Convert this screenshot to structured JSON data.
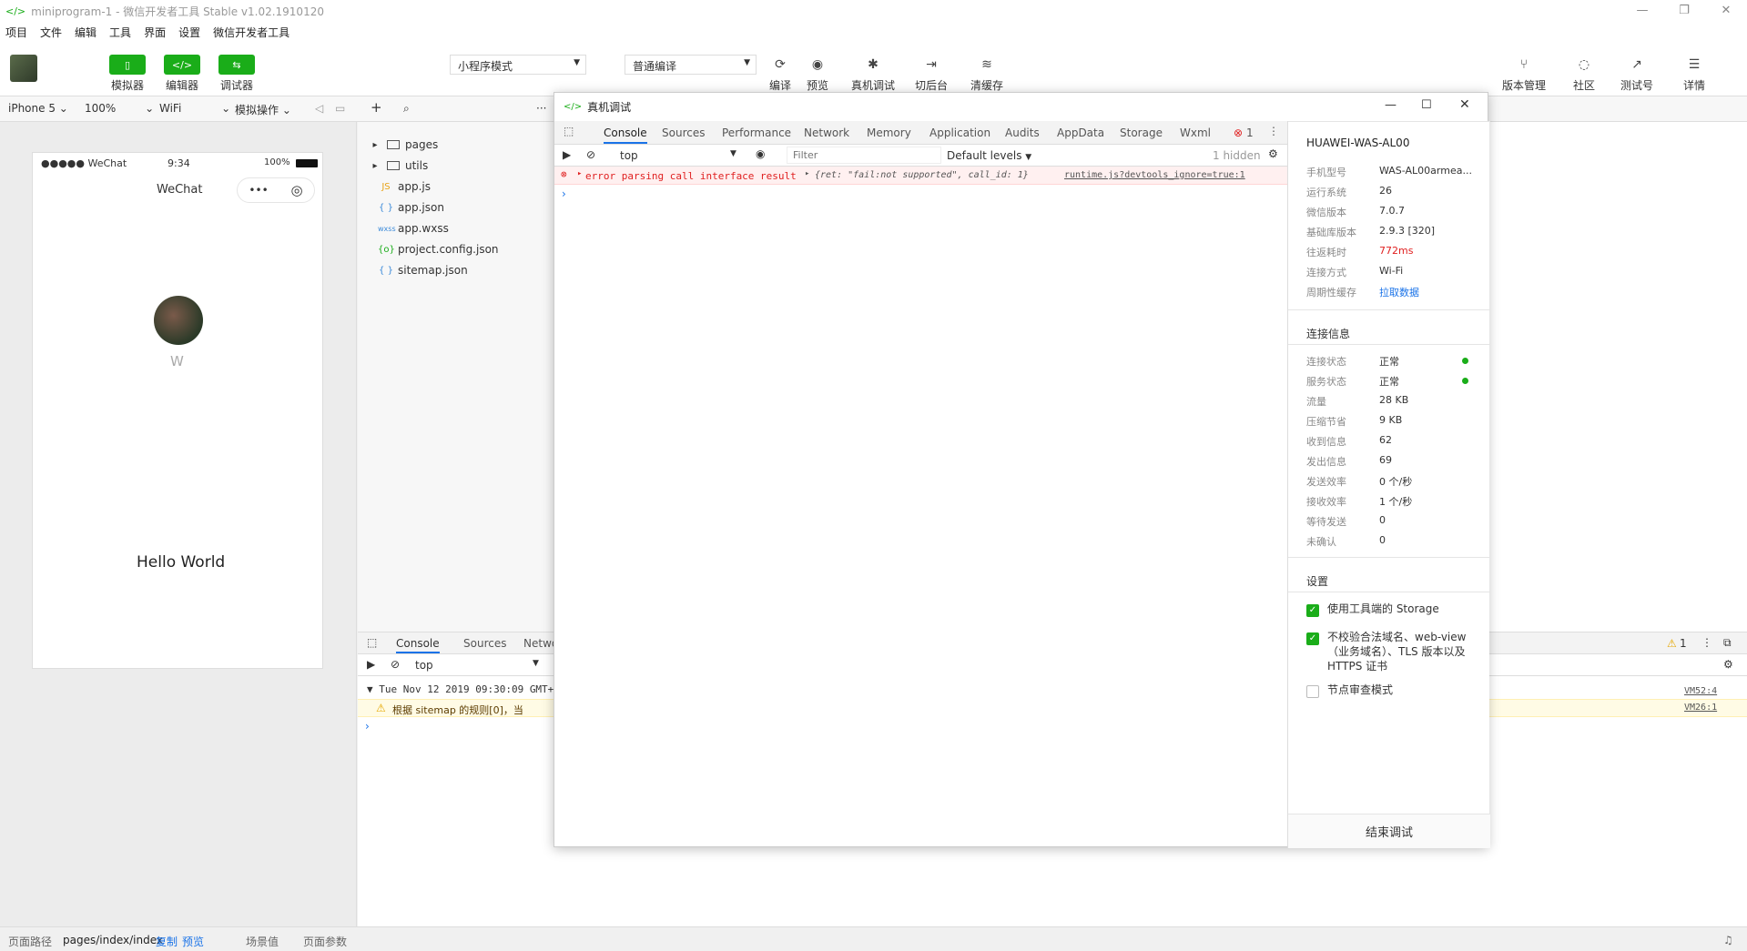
{
  "window": {
    "title": "miniprogram-1 - 微信开发者工具 Stable v1.02.1910120",
    "controls": [
      "—",
      "❐",
      "✕"
    ]
  },
  "menu": [
    "项目",
    "文件",
    "编辑",
    "工具",
    "界面",
    "设置",
    "微信开发者工具"
  ],
  "toolbar": {
    "simulator": "模拟器",
    "editor": "编辑器",
    "debugger": "调试器",
    "mode": "小程序模式",
    "compile_mode": "普通编译",
    "compile": "编译",
    "preview": "预览",
    "real_debug": "真机调试",
    "background": "切后台",
    "clear_cache": "清缓存",
    "version": "版本管理",
    "community": "社区",
    "test": "测试号",
    "details": "详情"
  },
  "sim_bar": {
    "device": "iPhone 5",
    "zoom": "100%",
    "network": "WiFi",
    "operation": "模拟操作"
  },
  "phone": {
    "carrier": "●●●●● WeChat",
    "time": "9:34",
    "battery": "100%",
    "nav_title": "WeChat",
    "avatar_name": "W",
    "hello": "Hello World"
  },
  "files": [
    {
      "icon": "▸",
      "type": "folder",
      "name": "pages"
    },
    {
      "icon": "▸",
      "type": "folder",
      "name": "utils"
    },
    {
      "icon": "JS",
      "type": "js",
      "name": "app.js"
    },
    {
      "icon": "{ }",
      "type": "json",
      "name": "app.json"
    },
    {
      "icon": "wxss",
      "type": "wxss",
      "name": "app.wxss"
    },
    {
      "icon": "{o}",
      "type": "cfg",
      "name": "project.config.json"
    },
    {
      "icon": "{ }",
      "type": "json",
      "name": "sitemap.json"
    }
  ],
  "bottom_devtools": {
    "tabs": [
      "Console",
      "Sources",
      "Netwo"
    ],
    "context": "top",
    "log_date": "Tue Nov 12 2019 09:30:09 GMT+",
    "warn_msg": "根据 sitemap 的规则[0]，当",
    "warn_count": "1",
    "link1": "VM52:4",
    "link2": "VM26:1"
  },
  "dialog": {
    "title": "真机调试",
    "tabs": [
      "Console",
      "Sources",
      "Performance",
      "Network",
      "Memory",
      "Application",
      "Audits",
      "AppData",
      "Storage",
      "Wxml"
    ],
    "error_count": "1",
    "context": "top",
    "filter_placeholder": "Filter",
    "levels": "Default levels",
    "hidden": "1 hidden",
    "error": {
      "msg": "error parsing call interface result",
      "obj": "{ret: \"fail:not supported\", call_id: 1}",
      "src": "runtime.js?devtools_ignore=true:1"
    },
    "device_name": "HUAWEI-WAS-AL00",
    "device_info": [
      {
        "k": "手机型号",
        "v": "WAS-AL00armea..."
      },
      {
        "k": "运行系统",
        "v": "26"
      },
      {
        "k": "微信版本",
        "v": "7.0.7"
      },
      {
        "k": "基础库版本",
        "v": "2.9.3 [320]"
      },
      {
        "k": "往返耗时",
        "v": "772ms",
        "red": true
      },
      {
        "k": "连接方式",
        "v": "Wi-Fi"
      },
      {
        "k": "周期性缓存",
        "v": "拉取数据",
        "link": true
      }
    ],
    "conn_title": "连接信息",
    "conn_info": [
      {
        "k": "连接状态",
        "v": "正常",
        "dot": true
      },
      {
        "k": "服务状态",
        "v": "正常",
        "dot": true
      },
      {
        "k": "流量",
        "v": "28 KB"
      },
      {
        "k": "压缩节省",
        "v": "9 KB"
      },
      {
        "k": "收到信息",
        "v": "62"
      },
      {
        "k": "发出信息",
        "v": "69"
      },
      {
        "k": "发送效率",
        "v": "0 个/秒"
      },
      {
        "k": "接收效率",
        "v": "1 个/秒"
      },
      {
        "k": "等待发送",
        "v": "0"
      },
      {
        "k": "未确认",
        "v": "0"
      }
    ],
    "settings_title": "设置",
    "settings": [
      {
        "label": "使用工具端的 Storage",
        "checked": true
      },
      {
        "label": "不校验合法域名、web-view（业务域名）、TLS 版本以及 HTTPS 证书",
        "checked": true
      },
      {
        "label": "节点审查模式",
        "checked": false
      }
    ],
    "end_button": "结束调试"
  },
  "status": {
    "path_label": "页面路径",
    "path": "pages/index/index",
    "copy": "复制",
    "preview": "预览",
    "scene": "场景值",
    "params": "页面参数"
  },
  "colors": {
    "green": "#1aad19",
    "error": "#e02020",
    "link": "#1a73e8"
  }
}
